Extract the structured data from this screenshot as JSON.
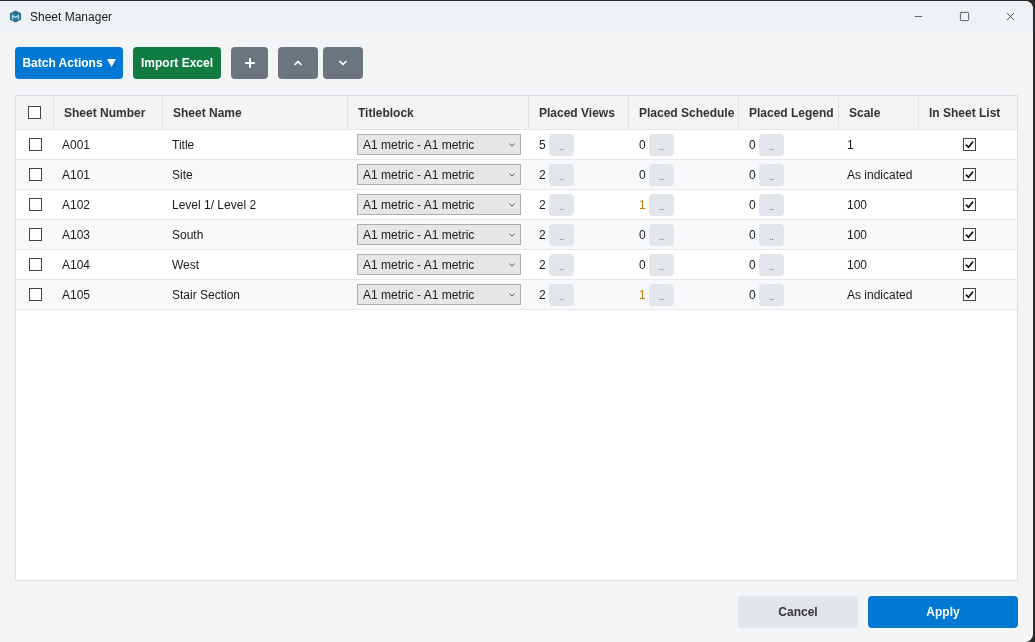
{
  "window": {
    "title": "Sheet Manager"
  },
  "toolbar": {
    "batch_actions": {
      "label": "Batch Actions"
    },
    "import_excel": {
      "label": "Import Excel"
    },
    "icon_buttons": [
      {
        "kind": "add"
      },
      {
        "kind": "up"
      },
      {
        "kind": "down"
      }
    ]
  },
  "table": {
    "select_all": {
      "checked": false
    },
    "columns": [
      "Sheet Number",
      "Sheet Name",
      "Titleblock",
      "Placed Views",
      "Placed Schedule",
      "Placed Legend",
      "Scale",
      "In Sheet List"
    ],
    "rows": [
      {
        "checked": false,
        "sheet_number": "A001",
        "sheet_name": "Title",
        "titleblock": "A1 metric - A1 metric",
        "placed_views": {
          "count": "5",
          "button": "..",
          "highlighted": false
        },
        "placed_schedule": {
          "count": "0",
          "button": "..",
          "highlighted": false
        },
        "placed_legend": {
          "count": "0",
          "button": "..",
          "highlighted": false
        },
        "scale": "1",
        "in_sheet_list": true
      },
      {
        "checked": false,
        "sheet_number": "A101",
        "sheet_name": "Site",
        "titleblock": "A1 metric - A1 metric",
        "placed_views": {
          "count": "2",
          "button": "..",
          "highlighted": false
        },
        "placed_schedule": {
          "count": "0",
          "button": "..",
          "highlighted": false
        },
        "placed_legend": {
          "count": "0",
          "button": "..",
          "highlighted": false
        },
        "scale": "As indicated",
        "in_sheet_list": true
      },
      {
        "checked": false,
        "sheet_number": "A102",
        "sheet_name": "Level 1/ Level 2",
        "titleblock": "A1 metric - A1 metric",
        "placed_views": {
          "count": "2",
          "button": "..",
          "highlighted": false
        },
        "placed_schedule": {
          "count": "1",
          "button": "..",
          "highlighted": true
        },
        "placed_legend": {
          "count": "0",
          "button": "..",
          "highlighted": false
        },
        "scale": "100",
        "in_sheet_list": true
      },
      {
        "checked": false,
        "sheet_number": "A103",
        "sheet_name": "South",
        "titleblock": "A1 metric - A1 metric",
        "placed_views": {
          "count": "2",
          "button": "..",
          "highlighted": false
        },
        "placed_schedule": {
          "count": "0",
          "button": "..",
          "highlighted": false
        },
        "placed_legend": {
          "count": "0",
          "button": "..",
          "highlighted": false
        },
        "scale": "100",
        "in_sheet_list": true
      },
      {
        "checked": false,
        "sheet_number": "A104",
        "sheet_name": "West",
        "titleblock": "A1 metric - A1 metric",
        "placed_views": {
          "count": "2",
          "button": "..",
          "highlighted": false
        },
        "placed_schedule": {
          "count": "0",
          "button": "..",
          "highlighted": false
        },
        "placed_legend": {
          "count": "0",
          "button": "..",
          "highlighted": false
        },
        "scale": "100",
        "in_sheet_list": true
      },
      {
        "checked": false,
        "sheet_number": "A105",
        "sheet_name": "Stair Section",
        "titleblock": "A1 metric - A1 metric",
        "placed_views": {
          "count": "2",
          "button": "..",
          "highlighted": false
        },
        "placed_schedule": {
          "count": "1",
          "button": "..",
          "highlighted": true
        },
        "placed_legend": {
          "count": "0",
          "button": "..",
          "highlighted": false
        },
        "scale": "As indicated",
        "in_sheet_list": true
      }
    ]
  },
  "footer": {
    "cancel": {
      "label": "Cancel"
    },
    "apply": {
      "label": "Apply"
    }
  }
}
